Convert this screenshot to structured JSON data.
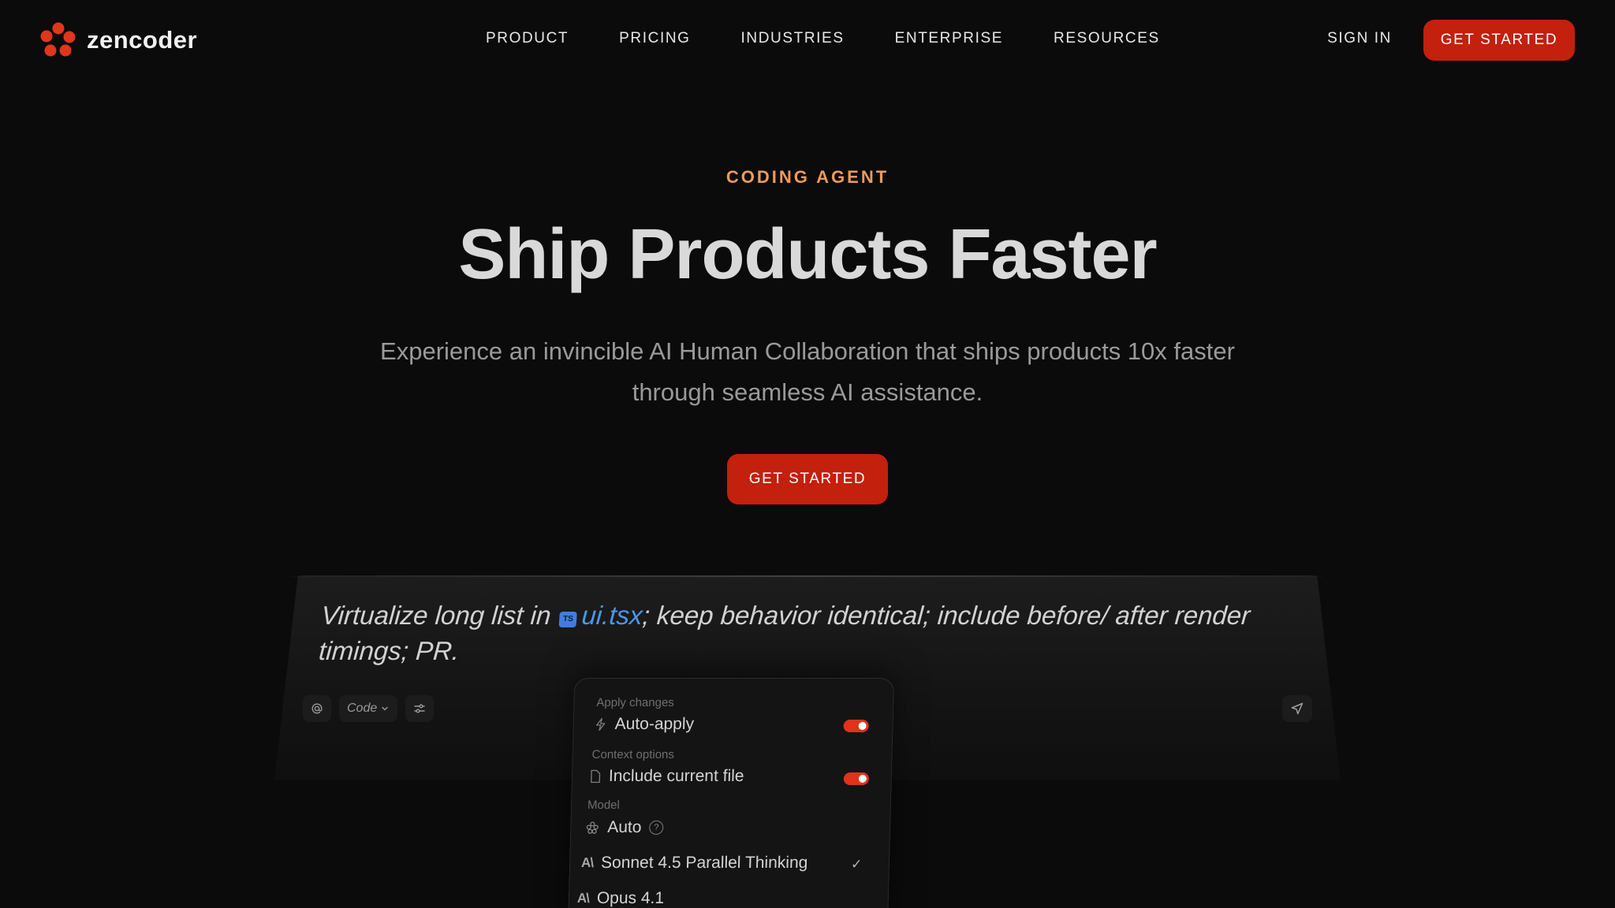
{
  "brand": {
    "name": "zencoder",
    "accent_color": "#c3200e",
    "logo_color": "#e0361c"
  },
  "nav": {
    "items": [
      {
        "label": "PRODUCT"
      },
      {
        "label": "PRICING"
      },
      {
        "label": "INDUSTRIES"
      },
      {
        "label": "ENTERPRISE"
      },
      {
        "label": "RESOURCES"
      }
    ],
    "sign_in_label": "SIGN IN",
    "cta_label": "GET STARTED"
  },
  "hero": {
    "eyebrow": "CODING AGENT",
    "title": "Ship Products Faster",
    "subtitle": "Experience an invincible AI Human Collaboration that ships products 10x faster through seamless AI assistance.",
    "cta_label": "GET STARTED"
  },
  "prompt_card": {
    "prompt_before": "Virtualize long list in",
    "file_badge": "TS",
    "file_name": "ui.tsx",
    "prompt_after": "; keep behavior identical; include before/ after render timings; PR.",
    "toolbar": {
      "mention_icon": "at-icon",
      "mode_label": "Code",
      "settings_icon": "sliders-icon",
      "send_icon": "send-icon"
    }
  },
  "options_panel": {
    "apply_section_label": "Apply changes",
    "auto_apply_label": "Auto-apply",
    "auto_apply_on": true,
    "context_section_label": "Context options",
    "include_file_label": "Include current file",
    "include_file_on": true,
    "model_section_label": "Model",
    "model_auto_label": "Auto",
    "help_glyph": "?",
    "provider_mark": "A\\",
    "models": [
      {
        "label": "Sonnet 4.5 Parallel Thinking",
        "selected": true
      },
      {
        "label": "Opus 4.1",
        "selected": false
      }
    ],
    "check_glyph": "✓"
  }
}
